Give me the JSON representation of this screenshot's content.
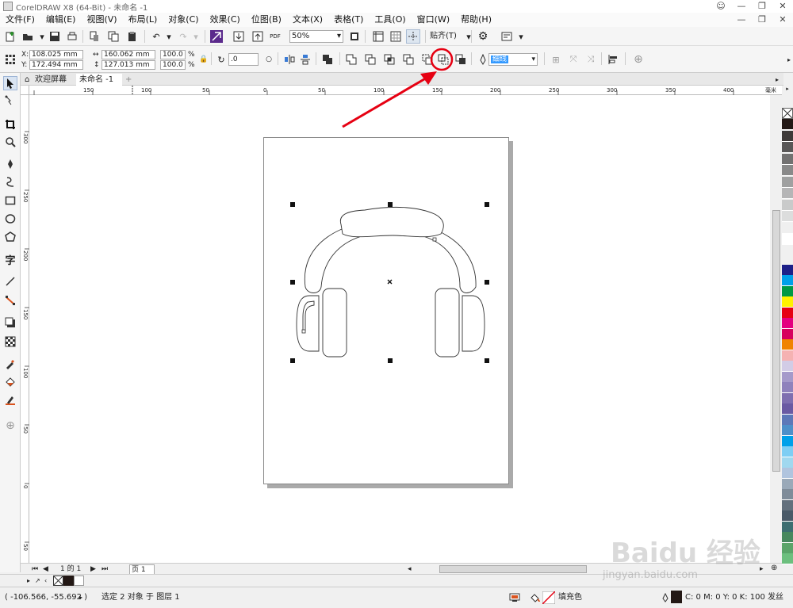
{
  "title": "CorelDRAW X8 (64-Bit) - 未命名 -1",
  "menu": [
    "文件(F)",
    "编辑(E)",
    "视图(V)",
    "布局(L)",
    "对象(C)",
    "效果(C)",
    "位图(B)",
    "文本(X)",
    "表格(T)",
    "工具(O)",
    "窗口(W)",
    "帮助(H)"
  ],
  "toolbar": {
    "zoom": "50%",
    "snap": "贴齐(T)"
  },
  "props": {
    "x": "108.025 mm",
    "y": "172.494 mm",
    "w": "160.062 mm",
    "h": "127.013 mm",
    "sx": "100.0",
    "sy": "100.0",
    "pct": "%",
    "angle": ".0",
    "outline": "细线"
  },
  "tabs": {
    "welcome": "欢迎屏幕",
    "doc": "未命名 -1"
  },
  "ruler_h": [
    "150",
    "100",
    "50",
    "0",
    "50",
    "100",
    "150",
    "200",
    "250",
    "300",
    "350",
    "400"
  ],
  "ruler_h_unit": "毫米",
  "ruler_v": [
    "300",
    "250",
    "200",
    "150",
    "100",
    "50",
    "0",
    "50"
  ],
  "pagenav": {
    "count": "1 的 1",
    "page": "页 1"
  },
  "status": {
    "coords": "( -106.566, -55.692 )",
    "selection": "选定 2 对象 于 图层 1",
    "fill": "填充色",
    "outline": "C: 0 M: 0 Y: 0 K: 100  发丝"
  },
  "watermark": "Baidu 经验",
  "watermark_url": "jingyan.baidu.com",
  "palette": [
    "#231815",
    "#3e3a39",
    "#595757",
    "#727171",
    "#898989",
    "#9fa0a0",
    "#b5b5b6",
    "#c9caca",
    "#dcdddd",
    "#efefef",
    "#ffffff",
    "#1d2088",
    "#00a0e9",
    "#009944",
    "#fff100",
    "#e60012",
    "#e4007f",
    "#d7005d",
    "#f08300",
    "#f5b2b2",
    "#d2cce6",
    "#a59aca",
    "#8f82bc",
    "#7f6fb0",
    "#6a5aa3",
    "#5d78b8",
    "#4e90c9",
    "#00a0e9",
    "#7ecef4",
    "#a0d8ef",
    "#b0c4de",
    "#9aa9b8",
    "#7f8c99",
    "#63707d",
    "#4a5a68",
    "#3c6e71",
    "#47885e",
    "#5aa469",
    "#6cbf7e",
    "#84cc95",
    "#9fd9a8",
    "#b9e4c0",
    "#a7d6c8"
  ],
  "colors": {
    "accent": "#e60012",
    "selection": "#3399ff"
  }
}
